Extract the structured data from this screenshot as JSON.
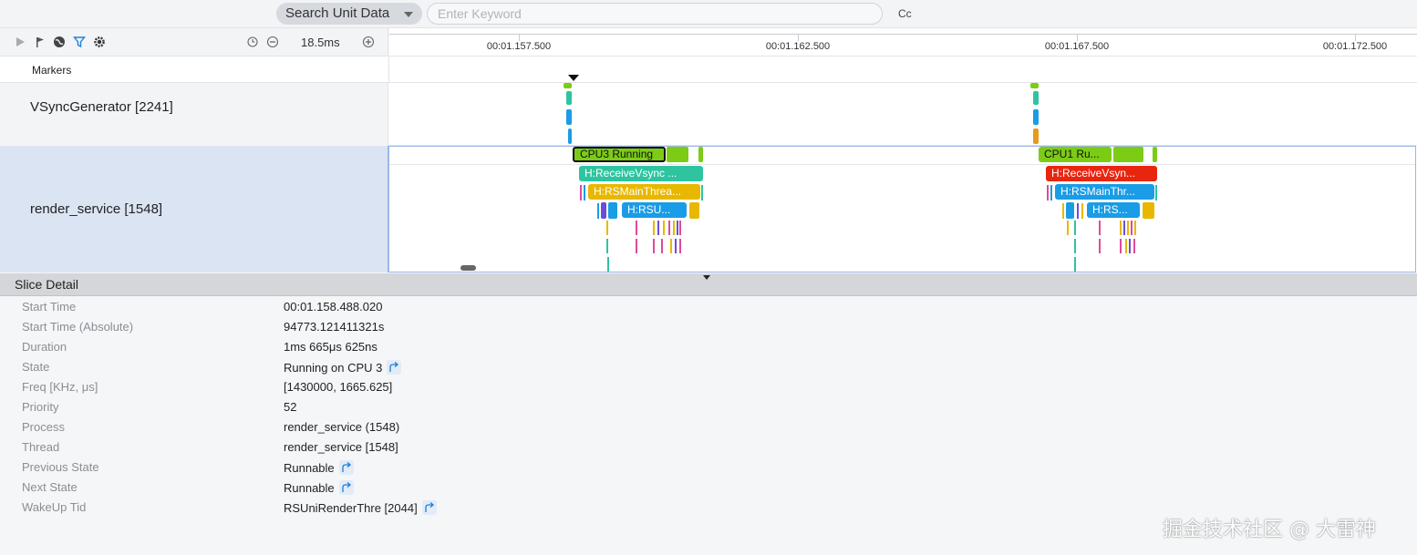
{
  "search": {
    "select_label": "Search Unit Data",
    "keyword_placeholder": "Enter Keyword",
    "case_label": "Cc"
  },
  "toolbar": {
    "zoom_value": "18.5ms",
    "icons": [
      "play-icon",
      "flag-icon",
      "globe-icon",
      "filter-icon",
      "gear-icon",
      "history-icon",
      "zoom-out-icon",
      "zoom-in-icon"
    ]
  },
  "ruler": {
    "ticks": [
      "00:01.157.500",
      "00:01.162.500",
      "00:01.167.500",
      "00:01.172.500"
    ]
  },
  "tracks": {
    "markers_label": "Markers",
    "vsync_label": "VSyncGenerator [2241]",
    "render_label": "render_service [1548]"
  },
  "slices": {
    "cpu_a": "CPU3 Running",
    "cpu_b": "CPU1 Ru...",
    "recv_a": "H:ReceiveVsync ...",
    "main_a": "H:RSMainThrea...",
    "rsu_a": "H:RSU...",
    "recv_b": "H:ReceiveVsyn...",
    "main_b": "H:RSMainThr...",
    "rsu_b": "H:RS..."
  },
  "colors": {
    "running_green": "#7ccc16",
    "receive_teal": "#2ec4a0",
    "receive_red": "#e8250f",
    "main_yellow": "#e8b800",
    "rsu_blue": "#1a9ce6"
  },
  "detail": {
    "title": "Slice Detail",
    "rows": [
      {
        "key": "Start Time",
        "value": "00:01.158.488.020"
      },
      {
        "key": "Start Time (Absolute)",
        "value": "94773.121411321s"
      },
      {
        "key": "Duration",
        "value": "1ms 665μs 625ns"
      },
      {
        "key": "State",
        "value": "Running on CPU 3"
      },
      {
        "key": "Freq [KHz, μs]",
        "value": "[1430000, 1665.625]"
      },
      {
        "key": "Priority",
        "value": "52"
      },
      {
        "key": "Process",
        "value": "render_service (1548)"
      },
      {
        "key": "Thread",
        "value": "render_service [1548]"
      },
      {
        "key": "Previous State",
        "value": "Runnable"
      },
      {
        "key": "Next State",
        "value": "Runnable"
      },
      {
        "key": "WakeUp Tid",
        "value": "RSUniRenderThre [2044]"
      }
    ]
  },
  "watermark": "掘金技术社区 @ 大雷神"
}
